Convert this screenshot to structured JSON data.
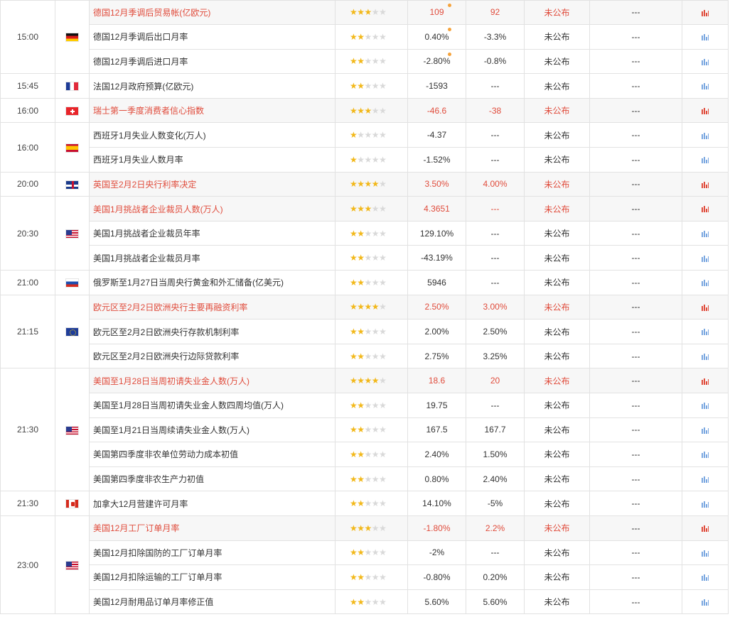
{
  "flags": {
    "de": "Germany",
    "fr": "France",
    "ch": "Switzerland",
    "es": "Spain",
    "gb": "United Kingdom",
    "us": "United States",
    "ru": "Russia",
    "eu": "Euro Area",
    "ca": "Canada"
  },
  "groups": [
    {
      "time": "15:00",
      "flag": "de",
      "rows": [
        {
          "event": "德国12月季调后贸易帐(亿欧元)",
          "stars": 3,
          "prev": "109",
          "forecast": "92",
          "actual": "未公布",
          "effect": "---",
          "hl": true,
          "dot": true
        },
        {
          "event": "德国12月季调后出口月率",
          "stars": 2,
          "prev": "0.40%",
          "forecast": "-3.3%",
          "actual": "未公布",
          "effect": "---",
          "hl": false,
          "dot": true
        },
        {
          "event": "德国12月季调后进口月率",
          "stars": 2,
          "prev": "-2.80%",
          "forecast": "-0.8%",
          "actual": "未公布",
          "effect": "---",
          "hl": false,
          "dot": true
        }
      ]
    },
    {
      "time": "15:45",
      "flag": "fr",
      "rows": [
        {
          "event": "法国12月政府预算(亿欧元)",
          "stars": 2,
          "prev": "-1593",
          "forecast": "---",
          "actual": "未公布",
          "effect": "---",
          "hl": false
        }
      ]
    },
    {
      "time": "16:00",
      "flag": "ch",
      "rows": [
        {
          "event": "瑞士第一季度消费者信心指数",
          "stars": 3,
          "prev": "-46.6",
          "forecast": "-38",
          "actual": "未公布",
          "effect": "---",
          "hl": true
        }
      ]
    },
    {
      "time": "16:00",
      "flag": "es",
      "rows": [
        {
          "event": "西班牙1月失业人数变化(万人)",
          "stars": 1,
          "prev": "-4.37",
          "forecast": "---",
          "actual": "未公布",
          "effect": "---",
          "hl": false
        },
        {
          "event": "西班牙1月失业人数月率",
          "stars": 1,
          "prev": "-1.52%",
          "forecast": "---",
          "actual": "未公布",
          "effect": "---",
          "hl": false
        }
      ]
    },
    {
      "time": "20:00",
      "flag": "gb",
      "rows": [
        {
          "event": "英国至2月2日央行利率决定",
          "stars": 4,
          "prev": "3.50%",
          "forecast": "4.00%",
          "actual": "未公布",
          "effect": "---",
          "hl": true
        }
      ]
    },
    {
      "time": "20:30",
      "flag": "us",
      "rows": [
        {
          "event": "美国1月挑战者企业裁员人数(万人)",
          "stars": 3,
          "prev": "4.3651",
          "forecast": "---",
          "actual": "未公布",
          "effect": "---",
          "hl": true
        },
        {
          "event": "美国1月挑战者企业裁员年率",
          "stars": 2,
          "prev": "129.10%",
          "forecast": "---",
          "actual": "未公布",
          "effect": "---",
          "hl": false
        },
        {
          "event": "美国1月挑战者企业裁员月率",
          "stars": 2,
          "prev": "-43.19%",
          "forecast": "---",
          "actual": "未公布",
          "effect": "---",
          "hl": false
        }
      ]
    },
    {
      "time": "21:00",
      "flag": "ru",
      "rows": [
        {
          "event": "俄罗斯至1月27日当周央行黄金和外汇储备(亿美元)",
          "stars": 2,
          "prev": "5946",
          "forecast": "---",
          "actual": "未公布",
          "effect": "---",
          "hl": false
        }
      ]
    },
    {
      "time": "21:15",
      "flag": "eu",
      "rows": [
        {
          "event": "欧元区至2月2日欧洲央行主要再融资利率",
          "stars": 4,
          "prev": "2.50%",
          "forecast": "3.00%",
          "actual": "未公布",
          "effect": "---",
          "hl": true
        },
        {
          "event": "欧元区至2月2日欧洲央行存款机制利率",
          "stars": 2,
          "prev": "2.00%",
          "forecast": "2.50%",
          "actual": "未公布",
          "effect": "---",
          "hl": false
        },
        {
          "event": "欧元区至2月2日欧洲央行边际贷款利率",
          "stars": 2,
          "prev": "2.75%",
          "forecast": "3.25%",
          "actual": "未公布",
          "effect": "---",
          "hl": false
        }
      ]
    },
    {
      "time": "21:30",
      "flag": "us",
      "rows": [
        {
          "event": "美国至1月28日当周初请失业金人数(万人)",
          "stars": 4,
          "prev": "18.6",
          "forecast": "20",
          "actual": "未公布",
          "effect": "---",
          "hl": true
        },
        {
          "event": "美国至1月28日当周初请失业金人数四周均值(万人)",
          "stars": 2,
          "prev": "19.75",
          "forecast": "---",
          "actual": "未公布",
          "effect": "---",
          "hl": false
        },
        {
          "event": "美国至1月21日当周续请失业金人数(万人)",
          "stars": 2,
          "prev": "167.5",
          "forecast": "167.7",
          "actual": "未公布",
          "effect": "---",
          "hl": false
        },
        {
          "event": "美国第四季度非农单位劳动力成本初值",
          "stars": 2,
          "prev": "2.40%",
          "forecast": "1.50%",
          "actual": "未公布",
          "effect": "---",
          "hl": false
        },
        {
          "event": "美国第四季度非农生产力初值",
          "stars": 2,
          "prev": "0.80%",
          "forecast": "2.40%",
          "actual": "未公布",
          "effect": "---",
          "hl": false
        }
      ]
    },
    {
      "time": "21:30",
      "flag": "ca",
      "rows": [
        {
          "event": "加拿大12月营建许可月率",
          "stars": 2,
          "prev": "14.10%",
          "forecast": "-5%",
          "actual": "未公布",
          "effect": "---",
          "hl": false
        }
      ]
    },
    {
      "time": "23:00",
      "flag": "us",
      "rows": [
        {
          "event": "美国12月工厂订单月率",
          "stars": 3,
          "prev": "-1.80%",
          "forecast": "2.2%",
          "actual": "未公布",
          "effect": "---",
          "hl": true
        },
        {
          "event": "美国12月扣除国防的工厂订单月率",
          "stars": 2,
          "prev": "-2%",
          "forecast": "---",
          "actual": "未公布",
          "effect": "---",
          "hl": false
        },
        {
          "event": "美国12月扣除运输的工厂订单月率",
          "stars": 2,
          "prev": "-0.80%",
          "forecast": "0.20%",
          "actual": "未公布",
          "effect": "---",
          "hl": false
        },
        {
          "event": "美国12月耐用品订单月率修正值",
          "stars": 2,
          "prev": "5.60%",
          "forecast": "5.60%",
          "actual": "未公布",
          "effect": "---",
          "hl": false
        }
      ]
    }
  ]
}
